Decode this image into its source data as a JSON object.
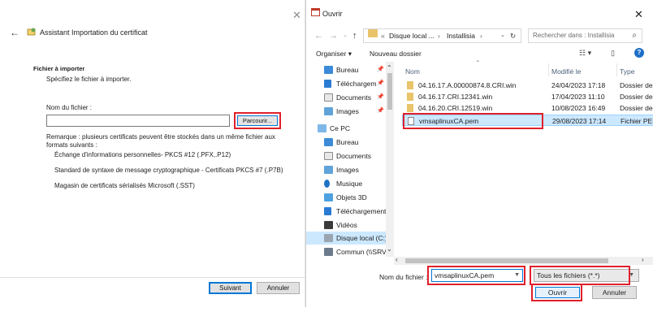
{
  "wizard": {
    "title": "Assistant Importation du certificat",
    "section_heading": "Fichier à importer",
    "section_subtitle": "Spécifiez le fichier à importer.",
    "filename_label": "Nom du fichier :",
    "filename_value": "",
    "browse_button": "Parcourir...",
    "note": "Remarque : plusieurs certificats peuvent être stockés dans un même fichier aux formats suivants :",
    "formats": [
      "Échange d'informations personnelles- PKCS #12 (.PFX,.P12)",
      "Standard de syntaxe de message cryptographique - Certificats PKCS #7 (.P7B)",
      "Magasin de certificats sérialisés Microsoft (.SST)"
    ],
    "next_button": "Suivant",
    "cancel_button": "Annuler"
  },
  "dialog": {
    "title": "Ouvrir",
    "breadcrumb": [
      "«",
      "Disque local ...",
      "›",
      "Installisia",
      "›"
    ],
    "search_placeholder": "Rechercher dans : Installisia",
    "toolbar": {
      "organize": "Organiser",
      "new_folder": "Nouveau dossier"
    },
    "nav_items": [
      {
        "label": "Bureau",
        "pinned": true,
        "icon": "desktop-icon"
      },
      {
        "label": "Téléchargeme",
        "pinned": true,
        "icon": "downloads-icon"
      },
      {
        "label": "Documents",
        "pinned": true,
        "icon": "documents-icon"
      },
      {
        "label": "Images",
        "pinned": true,
        "icon": "pictures-icon"
      },
      {
        "label": "Ce PC",
        "pinned": false,
        "icon": "computer-icon"
      },
      {
        "label": "Bureau",
        "pinned": false,
        "icon": "desktop-icon"
      },
      {
        "label": "Documents",
        "pinned": false,
        "icon": "documents-icon"
      },
      {
        "label": "Images",
        "pinned": false,
        "icon": "pictures-icon"
      },
      {
        "label": "Musique",
        "pinned": false,
        "icon": "music-icon"
      },
      {
        "label": "Objets 3D",
        "pinned": false,
        "icon": "3d-objects-icon"
      },
      {
        "label": "Téléchargement",
        "pinned": false,
        "icon": "downloads-icon"
      },
      {
        "label": "Vidéos",
        "pinned": false,
        "icon": "videos-icon"
      },
      {
        "label": "Disque local (C:)",
        "pinned": false,
        "icon": "drive-icon"
      },
      {
        "label": "Commun (\\\\SRV",
        "pinned": false,
        "icon": "network-drive-icon"
      }
    ],
    "columns": {
      "name": "Nom",
      "modified": "Modifié le",
      "type": "Type"
    },
    "files": [
      {
        "name": "04.16.17.A.00000874.8.CRI.win",
        "modified": "24/04/2023 17:18",
        "type": "Dossier de fichiers",
        "kind": "folder"
      },
      {
        "name": "04.16.17.CRI.12341.win",
        "modified": "17/04/2023 11:10",
        "type": "Dossier de fichiers",
        "kind": "folder"
      },
      {
        "name": "04.16.20.CRI.12519.win",
        "modified": "10/08/2023 16:49",
        "type": "Dossier de fichiers",
        "kind": "folder"
      },
      {
        "name": "vmsaplinuxCA.pem",
        "modified": "29/08/2023 17:14",
        "type": "Fichier PEM",
        "kind": "file"
      }
    ],
    "filename_label": "Nom du fichier :",
    "filename_value": "vmsaplinuxCA.pem",
    "filetype": "Tous les fichiers (*.*)",
    "open_button": "Ouvrir",
    "cancel_button": "Annuler"
  },
  "colors": {
    "accent": "#0078d7",
    "highlight": "#e0202c",
    "selection": "#cce8ff",
    "folder": "#e9c46a"
  }
}
